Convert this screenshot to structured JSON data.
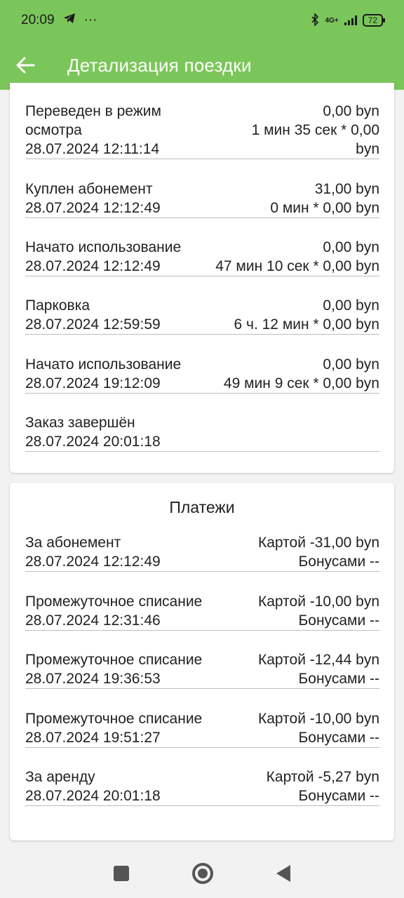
{
  "status": {
    "time": "20:09",
    "dots": "···",
    "network": "4G+",
    "battery": "72"
  },
  "header": {
    "title": "Детализация поездки"
  },
  "events": [
    {
      "title_line1": "Переведен в режим",
      "title_line2": "осмотра",
      "date": "28.07.2024 12:11:14",
      "amount": "0,00 byn",
      "detail_line1": "1 мин 35 сек * 0,00",
      "detail_line2": "byn"
    },
    {
      "title": "Куплен абонемент",
      "date": "28.07.2024 12:12:49",
      "amount": "31,00 byn",
      "detail": "0 мин * 0,00 byn"
    },
    {
      "title": "Начато использование",
      "date": "28.07.2024 12:12:49",
      "amount": "0,00 byn",
      "detail": "47 мин 10 сек * 0,00 byn"
    },
    {
      "title": "Парковка",
      "date": "28.07.2024 12:59:59",
      "amount": "0,00 byn",
      "detail": "6 ч. 12 мин * 0,00 byn"
    },
    {
      "title": "Начато использование",
      "date": "28.07.2024 19:12:09",
      "amount": "0,00 byn",
      "detail": "49 мин 9 сек * 0,00 byn"
    },
    {
      "title": "Заказ завершён",
      "date": "28.07.2024 20:01:18"
    }
  ],
  "payments": {
    "title": "Платежи",
    "items": [
      {
        "title": "За абонемент",
        "date": "28.07.2024 12:12:49",
        "card": "Картой -31,00 byn",
        "bonus": "Бонусами --"
      },
      {
        "title": "Промежуточное списание",
        "date": "28.07.2024 12:31:46",
        "card": "Картой -10,00 byn",
        "bonus": "Бонусами --"
      },
      {
        "title": "Промежуточное списание",
        "date": "28.07.2024 19:36:53",
        "card": "Картой -12,44 byn",
        "bonus": "Бонусами --"
      },
      {
        "title": "Промежуточное списание",
        "date": "28.07.2024 19:51:27",
        "card": "Картой -10,00 byn",
        "bonus": "Бонусами --"
      },
      {
        "title": "За аренду",
        "date": "28.07.2024 20:01:18",
        "card": "Картой -5,27 byn",
        "bonus": "Бонусами --"
      }
    ]
  },
  "colors": {
    "accent": "#7bc65a"
  }
}
